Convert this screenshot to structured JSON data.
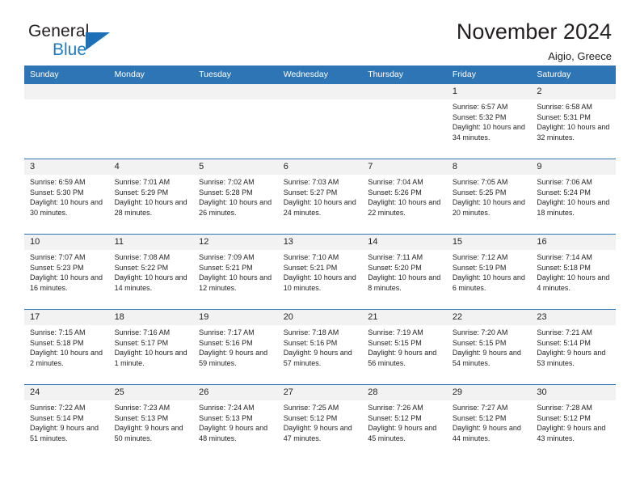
{
  "brand": {
    "name_top": "General",
    "name_bottom": "Blue",
    "triangle_color": "#1d6fb6",
    "blue_color": "#1d7cc4"
  },
  "header": {
    "title": "November 2024",
    "subtitle": "Aigio, Greece"
  },
  "theme": {
    "header_row_bg": "#2e75b6",
    "day_number_bg": "#f2f2f2",
    "cell_border": "#2e75b6",
    "text": "#231f20"
  },
  "weekday_headers": [
    "Sunday",
    "Monday",
    "Tuesday",
    "Wednesday",
    "Thursday",
    "Friday",
    "Saturday"
  ],
  "weeks": [
    [
      {
        "day": "",
        "sunrise": "",
        "sunset": "",
        "daylight": "",
        "empty": true
      },
      {
        "day": "",
        "sunrise": "",
        "sunset": "",
        "daylight": "",
        "empty": true
      },
      {
        "day": "",
        "sunrise": "",
        "sunset": "",
        "daylight": "",
        "empty": true
      },
      {
        "day": "",
        "sunrise": "",
        "sunset": "",
        "daylight": "",
        "empty": true
      },
      {
        "day": "",
        "sunrise": "",
        "sunset": "",
        "daylight": "",
        "empty": true
      },
      {
        "day": "1",
        "sunrise": "Sunrise: 6:57 AM",
        "sunset": "Sunset: 5:32 PM",
        "daylight": "Daylight: 10 hours and 34 minutes.",
        "empty": false
      },
      {
        "day": "2",
        "sunrise": "Sunrise: 6:58 AM",
        "sunset": "Sunset: 5:31 PM",
        "daylight": "Daylight: 10 hours and 32 minutes.",
        "empty": false
      }
    ],
    [
      {
        "day": "3",
        "sunrise": "Sunrise: 6:59 AM",
        "sunset": "Sunset: 5:30 PM",
        "daylight": "Daylight: 10 hours and 30 minutes.",
        "empty": false
      },
      {
        "day": "4",
        "sunrise": "Sunrise: 7:01 AM",
        "sunset": "Sunset: 5:29 PM",
        "daylight": "Daylight: 10 hours and 28 minutes.",
        "empty": false
      },
      {
        "day": "5",
        "sunrise": "Sunrise: 7:02 AM",
        "sunset": "Sunset: 5:28 PM",
        "daylight": "Daylight: 10 hours and 26 minutes.",
        "empty": false
      },
      {
        "day": "6",
        "sunrise": "Sunrise: 7:03 AM",
        "sunset": "Sunset: 5:27 PM",
        "daylight": "Daylight: 10 hours and 24 minutes.",
        "empty": false
      },
      {
        "day": "7",
        "sunrise": "Sunrise: 7:04 AM",
        "sunset": "Sunset: 5:26 PM",
        "daylight": "Daylight: 10 hours and 22 minutes.",
        "empty": false
      },
      {
        "day": "8",
        "sunrise": "Sunrise: 7:05 AM",
        "sunset": "Sunset: 5:25 PM",
        "daylight": "Daylight: 10 hours and 20 minutes.",
        "empty": false
      },
      {
        "day": "9",
        "sunrise": "Sunrise: 7:06 AM",
        "sunset": "Sunset: 5:24 PM",
        "daylight": "Daylight: 10 hours and 18 minutes.",
        "empty": false
      }
    ],
    [
      {
        "day": "10",
        "sunrise": "Sunrise: 7:07 AM",
        "sunset": "Sunset: 5:23 PM",
        "daylight": "Daylight: 10 hours and 16 minutes.",
        "empty": false
      },
      {
        "day": "11",
        "sunrise": "Sunrise: 7:08 AM",
        "sunset": "Sunset: 5:22 PM",
        "daylight": "Daylight: 10 hours and 14 minutes.",
        "empty": false
      },
      {
        "day": "12",
        "sunrise": "Sunrise: 7:09 AM",
        "sunset": "Sunset: 5:21 PM",
        "daylight": "Daylight: 10 hours and 12 minutes.",
        "empty": false
      },
      {
        "day": "13",
        "sunrise": "Sunrise: 7:10 AM",
        "sunset": "Sunset: 5:21 PM",
        "daylight": "Daylight: 10 hours and 10 minutes.",
        "empty": false
      },
      {
        "day": "14",
        "sunrise": "Sunrise: 7:11 AM",
        "sunset": "Sunset: 5:20 PM",
        "daylight": "Daylight: 10 hours and 8 minutes.",
        "empty": false
      },
      {
        "day": "15",
        "sunrise": "Sunrise: 7:12 AM",
        "sunset": "Sunset: 5:19 PM",
        "daylight": "Daylight: 10 hours and 6 minutes.",
        "empty": false
      },
      {
        "day": "16",
        "sunrise": "Sunrise: 7:14 AM",
        "sunset": "Sunset: 5:18 PM",
        "daylight": "Daylight: 10 hours and 4 minutes.",
        "empty": false
      }
    ],
    [
      {
        "day": "17",
        "sunrise": "Sunrise: 7:15 AM",
        "sunset": "Sunset: 5:18 PM",
        "daylight": "Daylight: 10 hours and 2 minutes.",
        "empty": false
      },
      {
        "day": "18",
        "sunrise": "Sunrise: 7:16 AM",
        "sunset": "Sunset: 5:17 PM",
        "daylight": "Daylight: 10 hours and 1 minute.",
        "empty": false
      },
      {
        "day": "19",
        "sunrise": "Sunrise: 7:17 AM",
        "sunset": "Sunset: 5:16 PM",
        "daylight": "Daylight: 9 hours and 59 minutes.",
        "empty": false
      },
      {
        "day": "20",
        "sunrise": "Sunrise: 7:18 AM",
        "sunset": "Sunset: 5:16 PM",
        "daylight": "Daylight: 9 hours and 57 minutes.",
        "empty": false
      },
      {
        "day": "21",
        "sunrise": "Sunrise: 7:19 AM",
        "sunset": "Sunset: 5:15 PM",
        "daylight": "Daylight: 9 hours and 56 minutes.",
        "empty": false
      },
      {
        "day": "22",
        "sunrise": "Sunrise: 7:20 AM",
        "sunset": "Sunset: 5:15 PM",
        "daylight": "Daylight: 9 hours and 54 minutes.",
        "empty": false
      },
      {
        "day": "23",
        "sunrise": "Sunrise: 7:21 AM",
        "sunset": "Sunset: 5:14 PM",
        "daylight": "Daylight: 9 hours and 53 minutes.",
        "empty": false
      }
    ],
    [
      {
        "day": "24",
        "sunrise": "Sunrise: 7:22 AM",
        "sunset": "Sunset: 5:14 PM",
        "daylight": "Daylight: 9 hours and 51 minutes.",
        "empty": false
      },
      {
        "day": "25",
        "sunrise": "Sunrise: 7:23 AM",
        "sunset": "Sunset: 5:13 PM",
        "daylight": "Daylight: 9 hours and 50 minutes.",
        "empty": false
      },
      {
        "day": "26",
        "sunrise": "Sunrise: 7:24 AM",
        "sunset": "Sunset: 5:13 PM",
        "daylight": "Daylight: 9 hours and 48 minutes.",
        "empty": false
      },
      {
        "day": "27",
        "sunrise": "Sunrise: 7:25 AM",
        "sunset": "Sunset: 5:12 PM",
        "daylight": "Daylight: 9 hours and 47 minutes.",
        "empty": false
      },
      {
        "day": "28",
        "sunrise": "Sunrise: 7:26 AM",
        "sunset": "Sunset: 5:12 PM",
        "daylight": "Daylight: 9 hours and 45 minutes.",
        "empty": false
      },
      {
        "day": "29",
        "sunrise": "Sunrise: 7:27 AM",
        "sunset": "Sunset: 5:12 PM",
        "daylight": "Daylight: 9 hours and 44 minutes.",
        "empty": false
      },
      {
        "day": "30",
        "sunrise": "Sunrise: 7:28 AM",
        "sunset": "Sunset: 5:12 PM",
        "daylight": "Daylight: 9 hours and 43 minutes.",
        "empty": false
      }
    ]
  ]
}
